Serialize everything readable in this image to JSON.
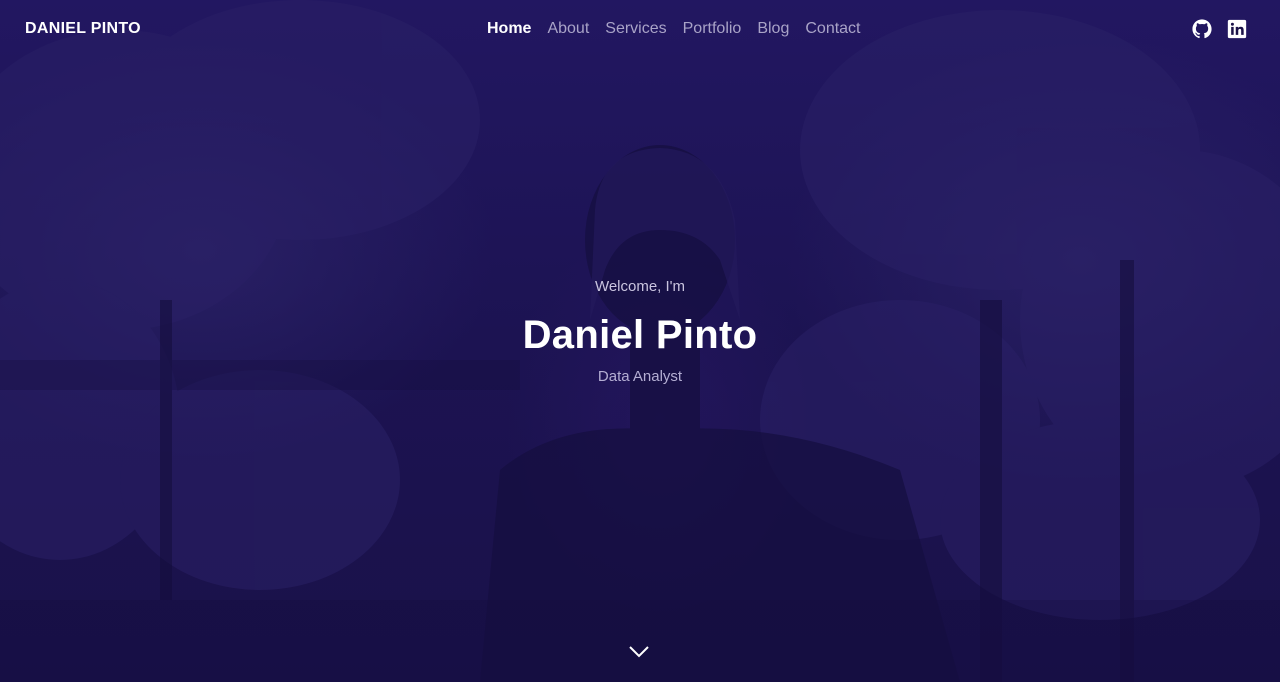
{
  "brand": "DANIEL PINTO",
  "nav": {
    "items": [
      {
        "label": "Home",
        "active": true
      },
      {
        "label": "About",
        "active": false
      },
      {
        "label": "Services",
        "active": false
      },
      {
        "label": "Portfolio",
        "active": false
      },
      {
        "label": "Blog",
        "active": false
      },
      {
        "label": "Contact",
        "active": false
      }
    ]
  },
  "socials": {
    "github_icon": "github-icon",
    "linkedin_icon": "linkedin-icon"
  },
  "hero": {
    "greeting": "Welcome, I'm",
    "name": "Daniel Pinto",
    "role": "Data Analyst",
    "scroll_icon": "chevron-down-icon"
  },
  "colors": {
    "overlay": "#1b1248",
    "text_primary": "#ffffff",
    "nav_inactive": "#a9a3c7"
  }
}
